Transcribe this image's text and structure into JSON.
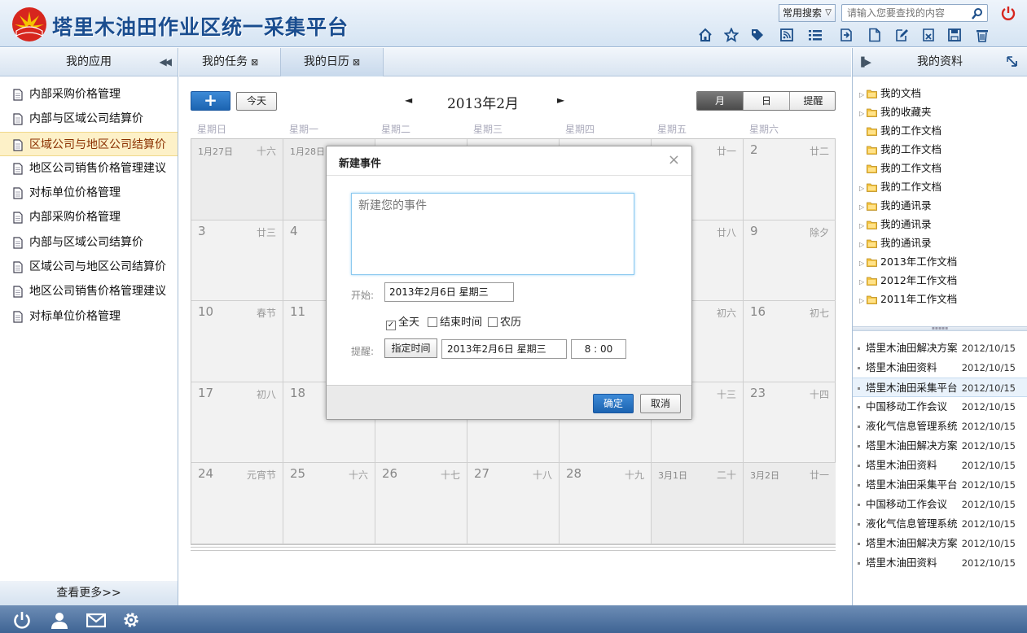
{
  "header": {
    "title": "塔里木油田作业区统一采集平台",
    "search_scope": "常用搜索",
    "search_placeholder": "请输入您要查找的内容",
    "toolbar_icons": [
      "home-icon",
      "star-icon",
      "tag-icon",
      "rss-icon",
      "list-icon",
      "export-icon",
      "document-icon",
      "edit-icon",
      "attachment-icon",
      "save-icon",
      "trash-icon"
    ]
  },
  "left_panel": {
    "title": "我的应用",
    "items": [
      {
        "label": "内部采购价格管理"
      },
      {
        "label": "内部与区域公司结算价"
      },
      {
        "label": "区域公司与地区公司结算价",
        "selected": true
      },
      {
        "label": "地区公司销售价格管理建议"
      },
      {
        "label": "对标单位价格管理"
      },
      {
        "label": "内部采购价格管理"
      },
      {
        "label": "内部与区域公司结算价"
      },
      {
        "label": "区域公司与地区公司结算价"
      },
      {
        "label": "地区公司销售价格管理建议"
      },
      {
        "label": "对标单位价格管理"
      }
    ],
    "more_label": "查看更多>>"
  },
  "tabs": [
    {
      "label": "我的任务",
      "close": "⊠"
    },
    {
      "label": "我的日历",
      "close": "⊠",
      "active": true
    }
  ],
  "calendar": {
    "add_label": "+",
    "today_label": "今天",
    "month_title": "2013年2月",
    "prev": "◄",
    "next": "►",
    "views": {
      "month": "月",
      "day": "日",
      "remind": "提醒"
    },
    "weekdays": [
      "星期日",
      "星期一",
      "星期二",
      "星期三",
      "星期四",
      "星期五",
      "星期六"
    ],
    "weeks": [
      [
        {
          "d": "1月27日",
          "l": "十六",
          "o": true
        },
        {
          "d": "1月28日",
          "l": "",
          "o": true
        },
        {
          "d": "",
          "l": ""
        },
        {
          "d": "",
          "l": ""
        },
        {
          "d": "",
          "l": ""
        },
        {
          "d": "",
          "l": "廿一"
        },
        {
          "d": "2",
          "l": "廿二"
        }
      ],
      [
        {
          "d": "3",
          "l": "廿三"
        },
        {
          "d": "4",
          "l": ""
        },
        {
          "d": "",
          "l": ""
        },
        {
          "d": "",
          "l": ""
        },
        {
          "d": "",
          "l": ""
        },
        {
          "d": "",
          "l": "廿八"
        },
        {
          "d": "9",
          "l": "除夕"
        }
      ],
      [
        {
          "d": "10",
          "l": "春节"
        },
        {
          "d": "11",
          "l": ""
        },
        {
          "d": "",
          "l": ""
        },
        {
          "d": "",
          "l": ""
        },
        {
          "d": "",
          "l": ""
        },
        {
          "d": "",
          "l": "初六"
        },
        {
          "d": "16",
          "l": "初七"
        }
      ],
      [
        {
          "d": "17",
          "l": "初八"
        },
        {
          "d": "18",
          "l": ""
        },
        {
          "d": "",
          "l": ""
        },
        {
          "d": "",
          "l": ""
        },
        {
          "d": "",
          "l": ""
        },
        {
          "d": "",
          "l": "十三"
        },
        {
          "d": "23",
          "l": "十四"
        }
      ],
      [
        {
          "d": "24",
          "l": "元宵节"
        },
        {
          "d": "25",
          "l": "十六"
        },
        {
          "d": "26",
          "l": "十七"
        },
        {
          "d": "27",
          "l": "十八"
        },
        {
          "d": "28",
          "l": "十九"
        },
        {
          "d": "3月1日",
          "l": "二十",
          "o": true
        },
        {
          "d": "3月2日",
          "l": "廿一",
          "o": true
        }
      ]
    ]
  },
  "dialog": {
    "title": "新建事件",
    "close": "×",
    "event_placeholder": "新建您的事件",
    "start_label": "开始:",
    "start_value": "2013年2月6日  星期三",
    "checks": [
      {
        "label": "全天",
        "checked": true
      },
      {
        "label": "结束时间",
        "checked": false
      },
      {
        "label": "农历",
        "checked": false
      }
    ],
    "remind_label": "提醒:",
    "remind_type": "指定时间",
    "remind_date": "2013年2月6日  星期三",
    "remind_time": "8 :  00",
    "ok_label": "确定",
    "cancel_label": "取消"
  },
  "right_panel": {
    "title": "我的资料",
    "tree": [
      {
        "label": "我的文档",
        "expandable": true
      },
      {
        "label": "我的收藏夹",
        "expandable": true
      },
      {
        "label": "我的工作文档",
        "expandable": false
      },
      {
        "label": "我的工作文档",
        "expandable": false
      },
      {
        "label": "我的工作文档",
        "expandable": false
      },
      {
        "label": "我的工作文档",
        "expandable": true
      },
      {
        "label": "我的通讯录",
        "expandable": true
      },
      {
        "label": "我的通讯录",
        "expandable": true
      },
      {
        "label": "我的通讯录",
        "expandable": true
      },
      {
        "label": "2013年工作文档",
        "expandable": true
      },
      {
        "label": "2012年工作文档",
        "expandable": true
      },
      {
        "label": "2011年工作文档",
        "expandable": true
      }
    ],
    "news": [
      {
        "title": "塔里木油田解决方案",
        "date": "2012/10/15"
      },
      {
        "title": "塔里木油田资料",
        "date": "2012/10/15"
      },
      {
        "title": "塔里木油田采集平台",
        "date": "2012/10/15",
        "selected": true
      },
      {
        "title": "中国移动工作会议",
        "date": "2012/10/15"
      },
      {
        "title": "液化气信息管理系统",
        "date": "2012/10/15"
      },
      {
        "title": "塔里木油田解决方案",
        "date": "2012/10/15"
      },
      {
        "title": "塔里木油田资料",
        "date": "2012/10/15"
      },
      {
        "title": "塔里木油田采集平台",
        "date": "2012/10/15"
      },
      {
        "title": "中国移动工作会议",
        "date": "2012/10/15"
      },
      {
        "title": "液化气信息管理系统",
        "date": "2012/10/15"
      },
      {
        "title": "塔里木油田解决方案",
        "date": "2012/10/15"
      },
      {
        "title": "塔里木油田资料",
        "date": "2012/10/15"
      }
    ]
  },
  "bottom_icons": [
    "power-icon",
    "user-icon",
    "mail-icon",
    "gear-icon"
  ],
  "colors": {
    "brand": "#1a4d8f",
    "primary_button": "#1c64b1",
    "selected_row": "#fdf1c8",
    "logo_red": "#d7261e",
    "logo_yellow": "#f5c400"
  }
}
